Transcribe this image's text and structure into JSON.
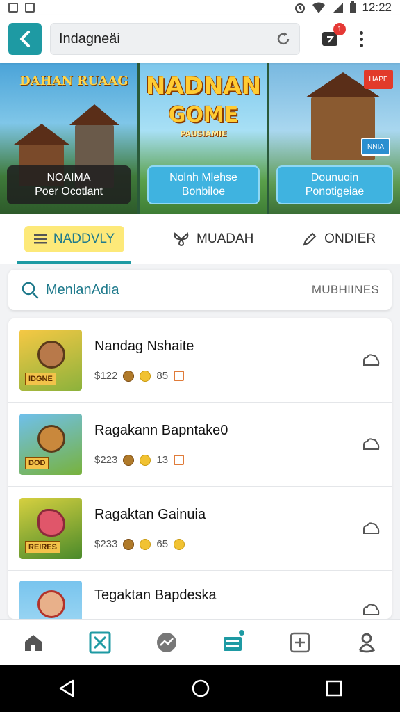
{
  "status_bar": {
    "time": "12:22",
    "left_icons": [
      "image-icon",
      "camera-icon"
    ],
    "right_icons": [
      "alarm-icon",
      "wifi-icon",
      "signal-icon",
      "battery-icon"
    ]
  },
  "app_bar": {
    "back_icon": "chevron-left-icon",
    "search_value": "Indagneäi",
    "refresh_icon": "refresh-icon",
    "notification_icon": "notification-icon",
    "notification_count": "1",
    "menu_icon": "kebab-menu-icon",
    "accent_color": "#1e9aa3"
  },
  "banners": [
    {
      "heading": "DAHAN RUAAG",
      "line1": "NOAIMA",
      "line2": "Poer Ocotlant"
    },
    {
      "heading_top": "NADNAN",
      "heading_bottom": "GOME",
      "subheading": "PAUSIAMIE",
      "line1": "Nolnh Mlehse",
      "line2": "Bonbiloe"
    },
    {
      "tag_top": "HAPE",
      "tag_bottom": "NNIA",
      "line1": "Dounuoin",
      "line2": "Ponotigeiae"
    }
  ],
  "tabs": [
    {
      "label": "NADDVLY",
      "icon": "menu-icon",
      "active": true
    },
    {
      "label": "MUADAH",
      "icon": "butterfly-icon",
      "active": false
    },
    {
      "label": "ONDIER",
      "icon": "pencil-icon",
      "active": false
    }
  ],
  "filter": {
    "value": "MenlanAdia",
    "right_label": "MUBHIINES",
    "icon": "search-icon"
  },
  "items": [
    {
      "title": "Nandag Nshaite",
      "price": "$122",
      "count": "85",
      "thumb_label": "IDGNE",
      "action_icon": "cloud-icon"
    },
    {
      "title": "Ragakann Bapntake0",
      "price": "$223",
      "count": "13",
      "thumb_label": "DOD",
      "action_icon": "cloud-icon"
    },
    {
      "title": "Ragaktan Gainuia",
      "price": "$233",
      "count": "65",
      "thumb_label": "REIRES",
      "action_icon": "cloud-icon"
    },
    {
      "title": "Tegaktan Bapdeska",
      "price": "",
      "count": "",
      "thumb_label": "",
      "action_icon": "cloud-icon"
    }
  ],
  "bottom_nav": [
    {
      "icon": "home-icon",
      "active": false
    },
    {
      "icon": "game-board-icon",
      "active": true
    },
    {
      "icon": "chart-icon",
      "active": false
    },
    {
      "icon": "wallet-icon",
      "active": true,
      "badge": true
    },
    {
      "icon": "add-square-icon",
      "active": false
    },
    {
      "icon": "profile-icon",
      "active": false
    }
  ],
  "system_nav": [
    "back-triangle-icon",
    "home-circle-icon",
    "recents-square-icon"
  ]
}
